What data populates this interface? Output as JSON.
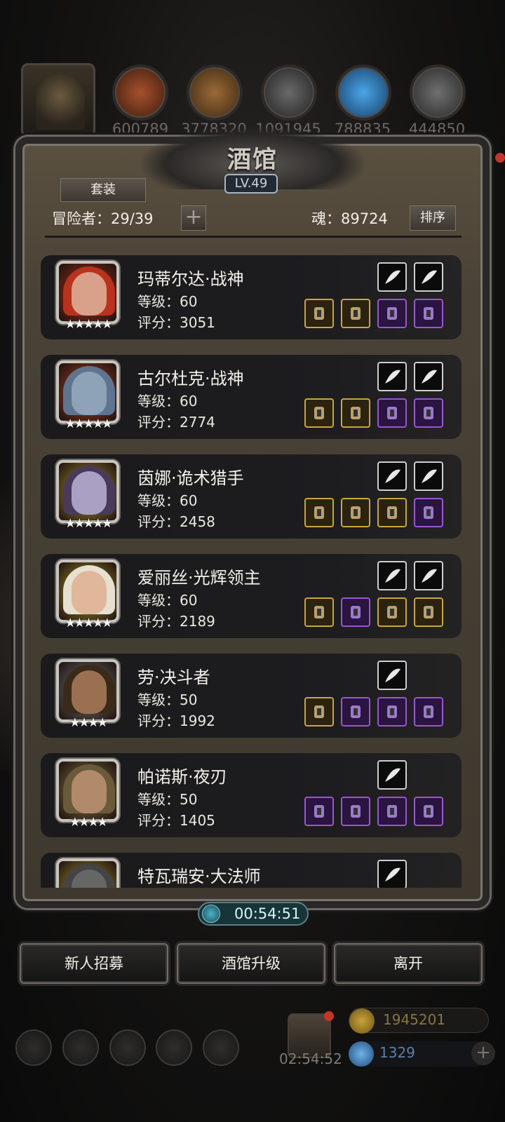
{
  "resources": {
    "values": [
      "600789",
      "3778320",
      "1091945",
      "788835",
      "444850"
    ]
  },
  "panel": {
    "title": "酒馆",
    "level": "LV.49",
    "tab_label": "套装",
    "adventurers": "冒险者：29/39",
    "plus_label": "+",
    "soul": "魂：89724",
    "sort_label": "排序"
  },
  "heroes": [
    {
      "name": "玛蒂尔达·战神",
      "level": "等级：60",
      "score": "评分：3051",
      "stars": "★★★★★",
      "top_slots": [
        "white",
        "white"
      ],
      "bottom_slots": [
        "gold",
        "gold",
        "purple",
        "purple"
      ]
    },
    {
      "name": "古尔杜克·战神",
      "level": "等级：60",
      "score": "评分：2774",
      "stars": "★★★★★",
      "top_slots": [
        "white",
        "white"
      ],
      "bottom_slots": [
        "gold",
        "gold",
        "purple",
        "purple"
      ]
    },
    {
      "name": "茵娜·诡术猎手",
      "level": "等级：60",
      "score": "评分：2458",
      "stars": "★★★★★",
      "top_slots": [
        "white",
        "white"
      ],
      "bottom_slots": [
        "gold",
        "gold",
        "gold",
        "purple"
      ]
    },
    {
      "name": "爱丽丝·光辉领主",
      "level": "等级：60",
      "score": "评分：2189",
      "stars": "★★★★★",
      "top_slots": [
        "white",
        "white"
      ],
      "bottom_slots": [
        "gold",
        "purple",
        "gold",
        "gold"
      ]
    },
    {
      "name": "劳·决斗者",
      "level": "等级：50",
      "score": "评分：1992",
      "stars": "★★★★",
      "top_slots": [
        "white"
      ],
      "bottom_slots": [
        "gold",
        "purple",
        "purple",
        "purple"
      ]
    },
    {
      "name": "帕诺斯·夜刃",
      "level": "等级：50",
      "score": "评分：1405",
      "stars": "★★★★",
      "top_slots": [
        "white"
      ],
      "bottom_slots": [
        "purple",
        "purple",
        "purple",
        "purple"
      ]
    },
    {
      "name": "特瓦瑞安·大法师",
      "level": "",
      "score": "",
      "stars": "",
      "top_slots": [
        "white"
      ],
      "bottom_slots": []
    }
  ],
  "timer": "00:54:51",
  "buttons": {
    "recruit": "新人招募",
    "upgrade": "酒馆升级",
    "leave": "离开"
  },
  "hud": {
    "gift_timer": "02:54:52",
    "gold": "1945201",
    "gems": "1329",
    "plus": "+"
  }
}
